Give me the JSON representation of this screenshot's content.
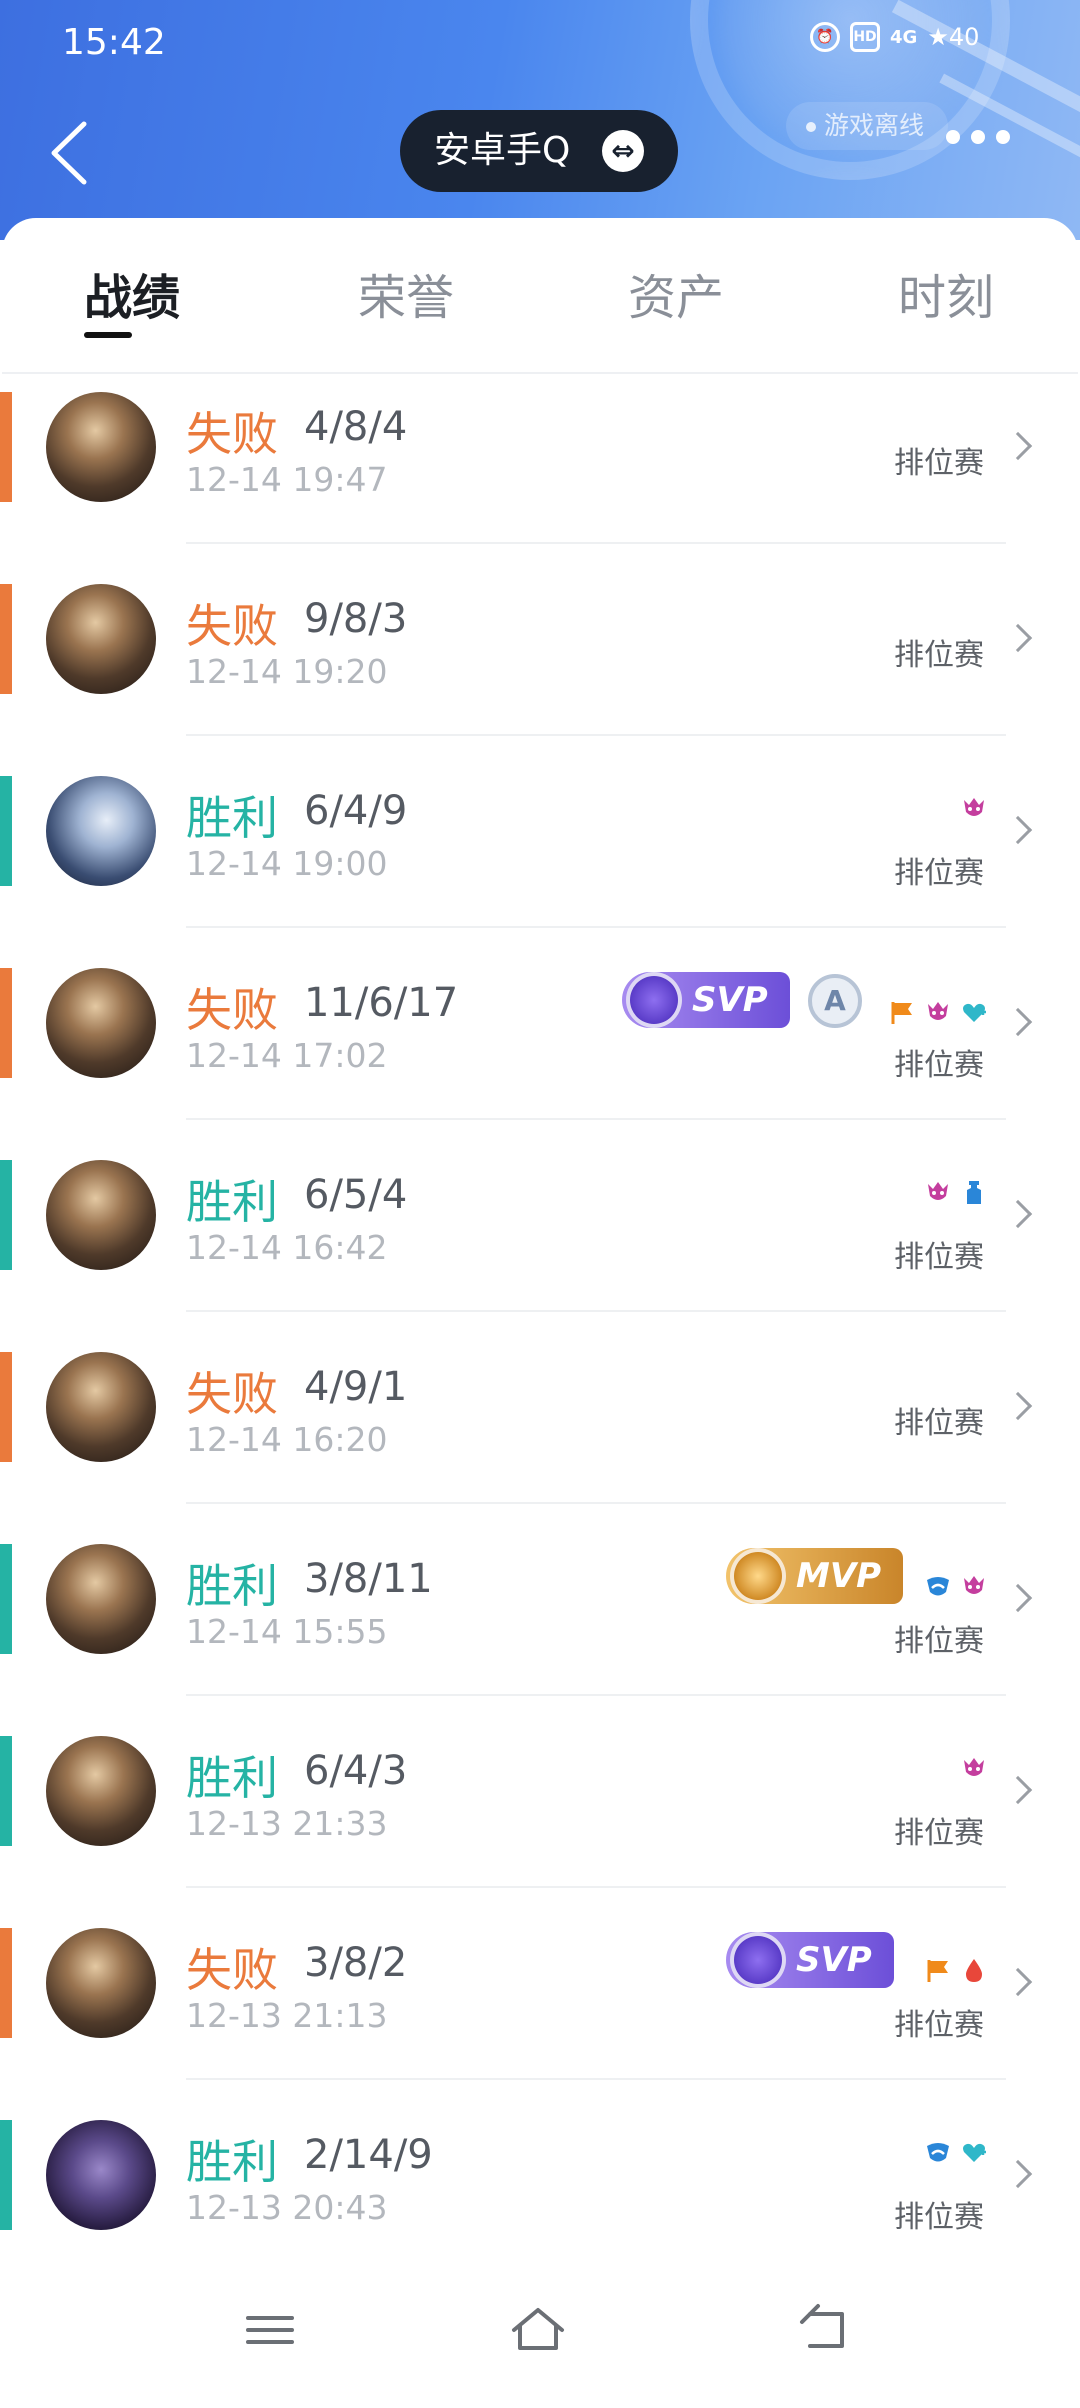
{
  "status_bar": {
    "time": "15:42",
    "network": "4G",
    "hd": "HD",
    "battery": "40"
  },
  "header": {
    "account_name": "安卓手Q",
    "swap_icon": "⇔",
    "offline_text": "游戏离线",
    "back_icon": "chevron-left",
    "more_icon": "more-dots"
  },
  "tabs": [
    {
      "label": "战绩",
      "active": true
    },
    {
      "label": "荣誉",
      "active": false
    },
    {
      "label": "资产",
      "active": false
    },
    {
      "label": "时刻",
      "active": false
    }
  ],
  "colors": {
    "lose": "#ea7a3c",
    "win": "#25b3a4",
    "header": "#4a86ee"
  },
  "matches": [
    {
      "result": "失败",
      "kda": "4/8/4",
      "time": "12-14 19:47",
      "mode": "排位赛"
    },
    {
      "result": "失败",
      "kda": "9/8/3",
      "time": "12-14 19:20",
      "mode": "排位赛"
    },
    {
      "result": "胜利",
      "kda": "6/4/9",
      "time": "12-14 19:00",
      "mode": "排位赛"
    },
    {
      "result": "失败",
      "kda": "11/6/17",
      "time": "12-14 17:02",
      "mode": "排位赛",
      "badge": "SVP",
      "grade": "A"
    },
    {
      "result": "胜利",
      "kda": "6/5/4",
      "time": "12-14 16:42",
      "mode": "排位赛"
    },
    {
      "result": "失败",
      "kda": "4/9/1",
      "time": "12-14 16:20",
      "mode": "排位赛"
    },
    {
      "result": "胜利",
      "kda": "3/8/11",
      "time": "12-14 15:55",
      "mode": "排位赛",
      "badge": "MVP"
    },
    {
      "result": "胜利",
      "kda": "6/4/3",
      "time": "12-13 21:33",
      "mode": "排位赛"
    },
    {
      "result": "失败",
      "kda": "3/8/2",
      "time": "12-13 21:13",
      "mode": "排位赛",
      "badge": "SVP"
    },
    {
      "result": "胜利",
      "kda": "2/14/9",
      "time": "12-13 20:43",
      "mode": "排位赛"
    }
  ],
  "nav": {
    "menu_icon": "menu-icon",
    "home_icon": "home-icon",
    "back_icon": "back-icon"
  }
}
